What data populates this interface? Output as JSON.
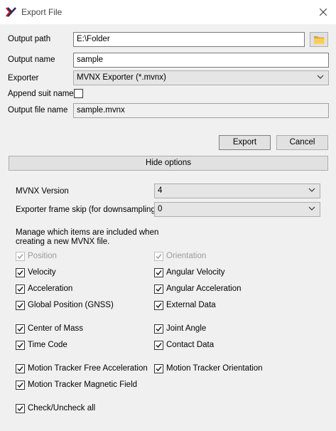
{
  "window": {
    "title": "Export File"
  },
  "form": {
    "output_path_label": "Output path",
    "output_path_value": "E:\\Folder",
    "output_name_label": "Output name",
    "output_name_value": "sample",
    "exporter_label": "Exporter",
    "exporter_value": "MVNX Exporter (*.mvnx)",
    "append_suit_label": "Append suit name",
    "append_suit_checked": false,
    "output_file_label": "Output file name",
    "output_file_value": "sample.mvnx"
  },
  "buttons": {
    "export": "Export",
    "cancel": "Cancel",
    "hide_options": "Hide options"
  },
  "options": {
    "mvnx_version_label": "MVNX Version",
    "mvnx_version_value": "4",
    "frame_skip_label": "Exporter frame skip (for downsampling)",
    "frame_skip_value": "0",
    "note_line1": "Manage which items are included when",
    "note_line2": "creating a new MVNX file."
  },
  "checkboxes": {
    "position": {
      "label": "Position",
      "checked": true,
      "enabled": false
    },
    "orientation": {
      "label": "Orientation",
      "checked": true,
      "enabled": false
    },
    "velocity": {
      "label": "Velocity",
      "checked": true,
      "enabled": true
    },
    "angular_velocity": {
      "label": "Angular Velocity",
      "checked": true,
      "enabled": true
    },
    "acceleration": {
      "label": "Acceleration",
      "checked": true,
      "enabled": true
    },
    "angular_acceleration": {
      "label": "Angular Acceleration",
      "checked": true,
      "enabled": true
    },
    "global_position": {
      "label": "Global Position (GNSS)",
      "checked": true,
      "enabled": true
    },
    "external_data": {
      "label": "External Data",
      "checked": true,
      "enabled": true
    },
    "center_of_mass": {
      "label": "Center of Mass",
      "checked": true,
      "enabled": true
    },
    "joint_angle": {
      "label": "Joint Angle",
      "checked": true,
      "enabled": true
    },
    "time_code": {
      "label": "Time Code",
      "checked": true,
      "enabled": true
    },
    "contact_data": {
      "label": "Contact Data",
      "checked": true,
      "enabled": true
    },
    "tracker_free_accel": {
      "label": "Motion Tracker Free Acceleration",
      "checked": true,
      "enabled": true
    },
    "tracker_orientation": {
      "label": "Motion Tracker Orientation",
      "checked": true,
      "enabled": true
    },
    "tracker_magnetic": {
      "label": "Motion Tracker Magnetic Field",
      "checked": true,
      "enabled": true
    },
    "check_all": {
      "label": "Check/Uncheck all",
      "checked": true,
      "enabled": true
    }
  },
  "icons": {
    "app": "xsens-x-icon",
    "close": "close-icon",
    "folder": "folder-icon",
    "dropdown": "chevron-down-icon",
    "check": "checkmark-icon"
  },
  "colors": {
    "accent_red": "#d6262c",
    "folder_yellow": "#f2c14e"
  }
}
